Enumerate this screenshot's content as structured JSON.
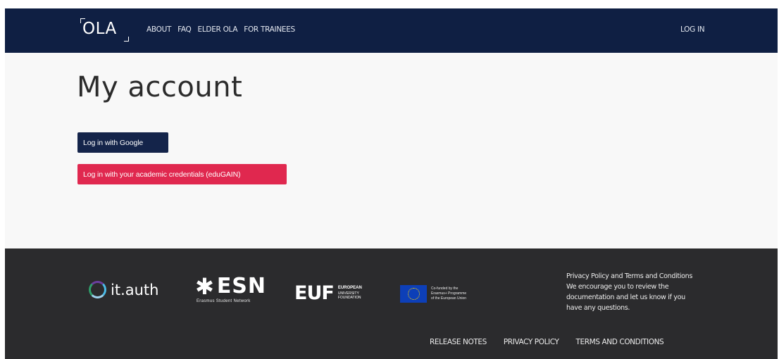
{
  "navbar": {
    "brand": "OLA",
    "links": [
      {
        "label": "ABOUT"
      },
      {
        "label": "FAQ"
      },
      {
        "label": "ELDER OLA"
      },
      {
        "label": "FOR TRAINEES"
      }
    ],
    "login": "LOG IN"
  },
  "main": {
    "title": "My account",
    "google_button": "Log in with Google",
    "edugain_button": "Log in with your academic credentials (eduGAIN)"
  },
  "footer": {
    "logos": {
      "itauth": "it.auth",
      "esn": "ESN",
      "esn_sub": "Erasmus Student Network",
      "euf": "EUF",
      "euf_sub": [
        "EUROPEAN",
        "UNIVERSITY",
        "FOUNDATION"
      ],
      "eu_text": [
        "Co-funded by the",
        "Erasmus+ Programme",
        "of the European Union"
      ]
    },
    "text_lines": [
      "Privacy Policy and Terms and Conditions",
      "We encourage you to review the",
      "documentation and let us know if you",
      "have any questions."
    ],
    "links": [
      {
        "label": "RELEASE NOTES"
      },
      {
        "label": "PRIVACY POLICY"
      },
      {
        "label": "TERMS AND CONDITIONS"
      }
    ]
  },
  "colors": {
    "navbar_bg": "#0f1f43",
    "google_button_bg": "#14244a",
    "edugain_button_bg": "#e0284f",
    "footer_bg": "#2b2b2d"
  }
}
